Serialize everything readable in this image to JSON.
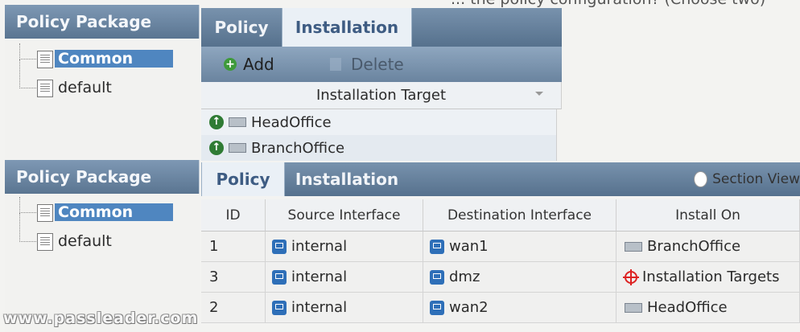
{
  "question_text": "... the policy configuration? (Choose two)",
  "top": {
    "policy_package_title": "Policy Package",
    "tree_items": [
      {
        "label": "Common",
        "selected": true
      },
      {
        "label": "default",
        "selected": false
      }
    ],
    "tabs": [
      {
        "label": "Policy",
        "active": false
      },
      {
        "label": "Installation",
        "active": true
      }
    ],
    "toolbar": {
      "add_label": "Add",
      "delete_label": "Delete"
    },
    "target_column": "Installation Target",
    "targets": [
      "HeadOffice",
      "BranchOffice"
    ]
  },
  "bottom": {
    "policy_package_title": "Policy Package",
    "tree_items": [
      {
        "label": "Common",
        "selected": true
      },
      {
        "label": "default",
        "selected": false
      }
    ],
    "tabs": [
      {
        "label": "Policy",
        "active": true
      },
      {
        "label": "Installation",
        "active": false
      }
    ],
    "section_view_label": "Section View",
    "columns": [
      "ID",
      "Source Interface",
      "Destination Interface",
      "Install On"
    ],
    "rows": [
      {
        "id": "1",
        "src": "internal",
        "dst": "wan1",
        "install_on": "BranchOffice",
        "install_icon": "device-icon"
      },
      {
        "id": "3",
        "src": "internal",
        "dst": "dmz",
        "install_on": "Installation Targets",
        "install_icon": "crosshair-icon"
      },
      {
        "id": "2",
        "src": "internal",
        "dst": "wan2",
        "install_on": "HeadOffice",
        "install_icon": "device-icon"
      }
    ]
  },
  "watermark": "www.passleader.com"
}
